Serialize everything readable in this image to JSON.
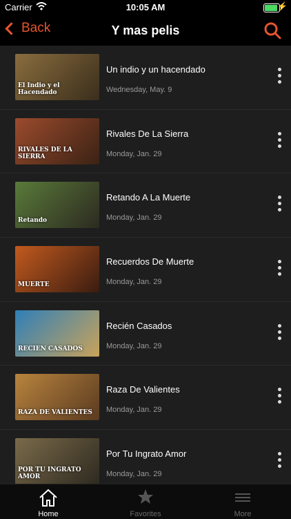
{
  "status_bar": {
    "carrier": "Carrier",
    "time": "10:05 AM"
  },
  "nav": {
    "back_label": "Back",
    "title": "Y mas pelis"
  },
  "movies": [
    {
      "title": "Un indio y un hacendado",
      "date": "Wednesday, May. 9",
      "thumb_text": "El Indio y el Hacendado",
      "thumb_colors": [
        "#8a6d3e",
        "#3a2e1c"
      ]
    },
    {
      "title": "Rivales De La Sierra",
      "date": "Monday, Jan. 29",
      "thumb_text": "RIVALES DE LA SIERRA",
      "thumb_colors": [
        "#9b4b2d",
        "#3b2214"
      ]
    },
    {
      "title": "Retando A La Muerte",
      "date": "Monday, Jan. 29",
      "thumb_text": "Retando",
      "thumb_colors": [
        "#5a7a3a",
        "#2c2a20"
      ]
    },
    {
      "title": "Recuerdos De Muerte",
      "date": "Monday, Jan. 29",
      "thumb_text": "MUERTE",
      "thumb_colors": [
        "#c25a1e",
        "#3a1c10"
      ]
    },
    {
      "title": "Recién Casados",
      "date": "Monday, Jan. 29",
      "thumb_text": "RECIEN CASADOS",
      "thumb_colors": [
        "#2f7fb8",
        "#c9a35a"
      ]
    },
    {
      "title": "Raza De Valientes",
      "date": "Monday, Jan. 29",
      "thumb_text": "RAZA DE VALIENTES",
      "thumb_colors": [
        "#b8843e",
        "#5a3a20"
      ]
    },
    {
      "title": "Por Tu Ingrato Amor",
      "date": "Monday, Jan. 29",
      "thumb_text": "POR TU INGRATO AMOR",
      "thumb_colors": [
        "#7a6a4a",
        "#2e2a20"
      ]
    }
  ],
  "tabs": [
    {
      "label": "Home",
      "icon": "home-icon",
      "active": true
    },
    {
      "label": "Favorites",
      "icon": "star-icon",
      "active": false
    },
    {
      "label": "More",
      "icon": "menu-icon",
      "active": false
    }
  ],
  "colors": {
    "accent": "#e8552e",
    "inactive_tab": "#6b6b6b"
  }
}
